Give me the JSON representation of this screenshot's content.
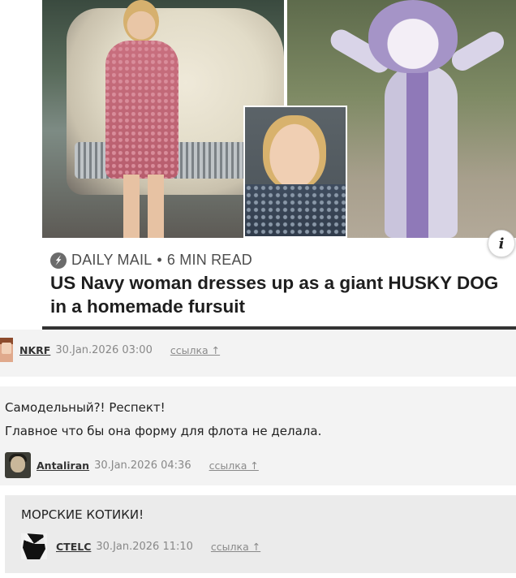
{
  "article": {
    "source": "DAILY MAIL",
    "separator": "•",
    "read_time": "6 MIN READ",
    "headline": "US Navy woman dresses up as a giant HUSKY DOG in a homemade fursuit",
    "info_badge": "i",
    "source_icon": "lightning-bolt-icon",
    "accent_colors": {
      "headline": "#1e1e1e",
      "meta": "#4d4d4d"
    }
  },
  "comments": [
    {
      "username": "NKRF",
      "timestamp": "30.Jan.2026 03:00",
      "link_label": "ссылка ↑",
      "avatar_icon": "anime-avatar-icon"
    },
    {
      "lines": [
        "Самодельный?! Респект!",
        "Главное что бы она форму для флота не делала."
      ],
      "username": "Antaliran",
      "timestamp": "30.Jan.2026 04:36",
      "link_label": "ссылка ↑",
      "avatar_icon": "portrait-avatar-icon"
    },
    {
      "lines": [
        "МОРСКИЕ КОТИКИ!"
      ],
      "username": "CTELC",
      "timestamp": "30.Jan.2026 11:10",
      "link_label": "ссылка ↑",
      "avatar_icon": "anime-avatar-icon"
    }
  ]
}
